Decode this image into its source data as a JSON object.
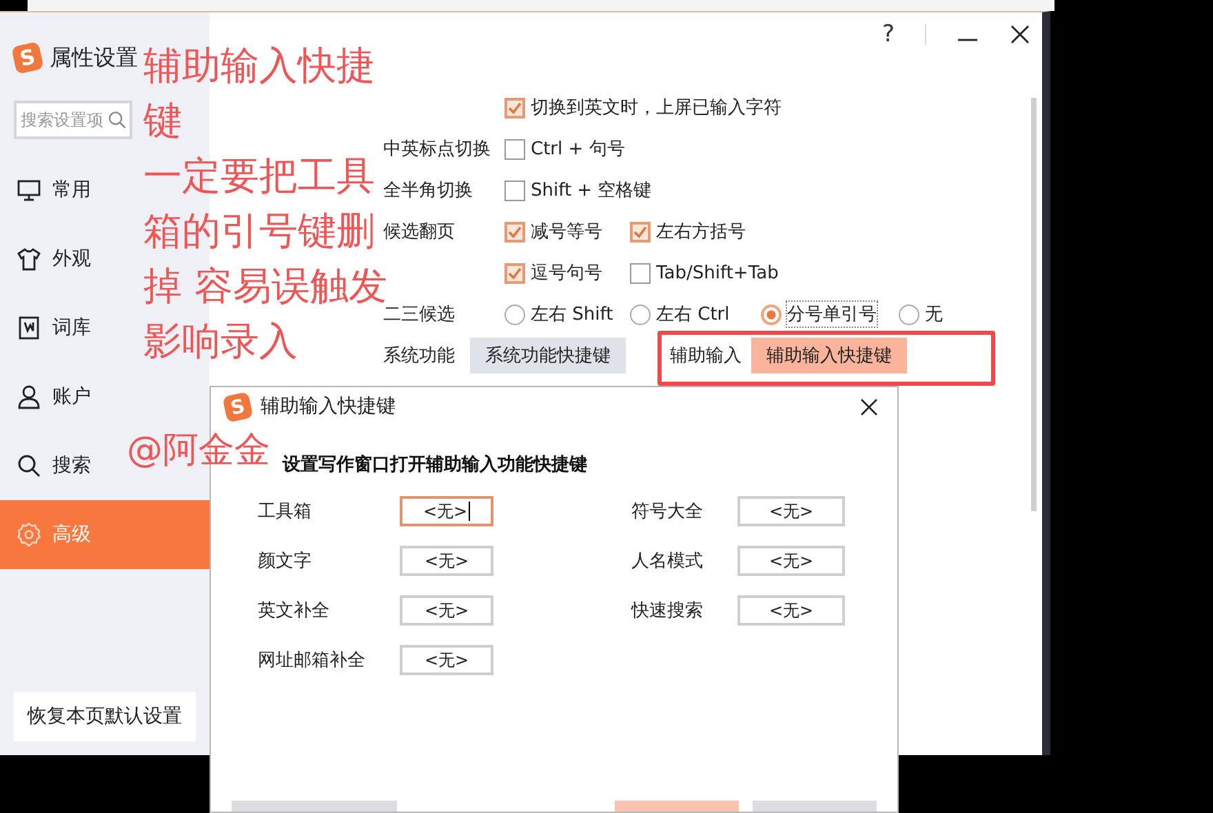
{
  "window": {
    "logo": "S",
    "title": "属性设置",
    "help": "?"
  },
  "sidebar": {
    "search": {
      "placeholder": "搜索设置项"
    },
    "items": [
      {
        "label": "常用",
        "selected": false
      },
      {
        "label": "外观",
        "selected": false
      },
      {
        "label": "词库",
        "selected": false
      },
      {
        "label": "账户",
        "selected": false
      },
      {
        "label": "搜索",
        "selected": false
      },
      {
        "label": "高级",
        "selected": true
      }
    ],
    "reset_button": "恢复本页默认设置"
  },
  "settings": [
    {
      "kind": "checkbox",
      "options": [
        {
          "text": "切换到英文时，上屏已输入字符",
          "checked": true
        }
      ]
    },
    {
      "label": "中英标点切换",
      "kind": "checkbox",
      "options": [
        {
          "text": "Ctrl + 句号",
          "checked": false
        }
      ]
    },
    {
      "label": "全半角切换",
      "kind": "checkbox",
      "options": [
        {
          "text": "Shift + 空格键",
          "checked": false
        }
      ]
    },
    {
      "label": "候选翻页",
      "kind": "checkbox",
      "options": [
        {
          "text": "减号等号",
          "checked": true
        },
        {
          "text": "左右方括号",
          "checked": true
        }
      ]
    },
    {
      "kind": "checkbox",
      "options": [
        {
          "text": "逗号句号",
          "checked": true
        },
        {
          "text": "Tab/Shift+Tab",
          "checked": false
        }
      ]
    },
    {
      "label": "二三候选",
      "kind": "radio",
      "options": [
        {
          "text": "左右 Shift",
          "selected": false
        },
        {
          "text": "左右 Ctrl",
          "selected": false
        },
        {
          "text": "分号单引号",
          "selected": true
        },
        {
          "text": "无",
          "selected": false
        }
      ]
    },
    {
      "kind": "buttons",
      "options": [
        {
          "text": "系统功能",
          "button": "系统功能快捷键",
          "highlighted": false
        },
        {
          "text": "辅助输入",
          "button": "辅助输入快捷键",
          "highlighted": true
        }
      ]
    }
  ],
  "dialog": {
    "logo": "S",
    "title": "辅助输入快捷键",
    "heading": "设置写作窗口打开辅助输入功能快捷键",
    "fields": [
      {
        "label": "工具箱",
        "value": "<无>",
        "focused": true
      },
      {
        "label": "符号大全",
        "value": "<无>",
        "focused": false
      },
      {
        "label": "颜文字",
        "value": "<无>",
        "focused": false
      },
      {
        "label": "人名模式",
        "value": "<无>",
        "focused": false
      },
      {
        "label": "英文补全",
        "value": "<无>",
        "focused": false
      },
      {
        "label": "快速搜索",
        "value": "<无>",
        "focused": false
      },
      {
        "label": "网址邮箱补全",
        "value": "<无>",
        "focused": false
      }
    ],
    "footer_buttons": [
      {
        "primary": false
      },
      {
        "primary": true
      },
      {
        "primary": false
      }
    ]
  },
  "annotation": {
    "note_lines": [
      "辅助输入快捷",
      "键",
      "一定要把工具",
      "箱的引号键删",
      "掉 容易误触发",
      "影响录入"
    ],
    "signature": "@阿金金"
  }
}
